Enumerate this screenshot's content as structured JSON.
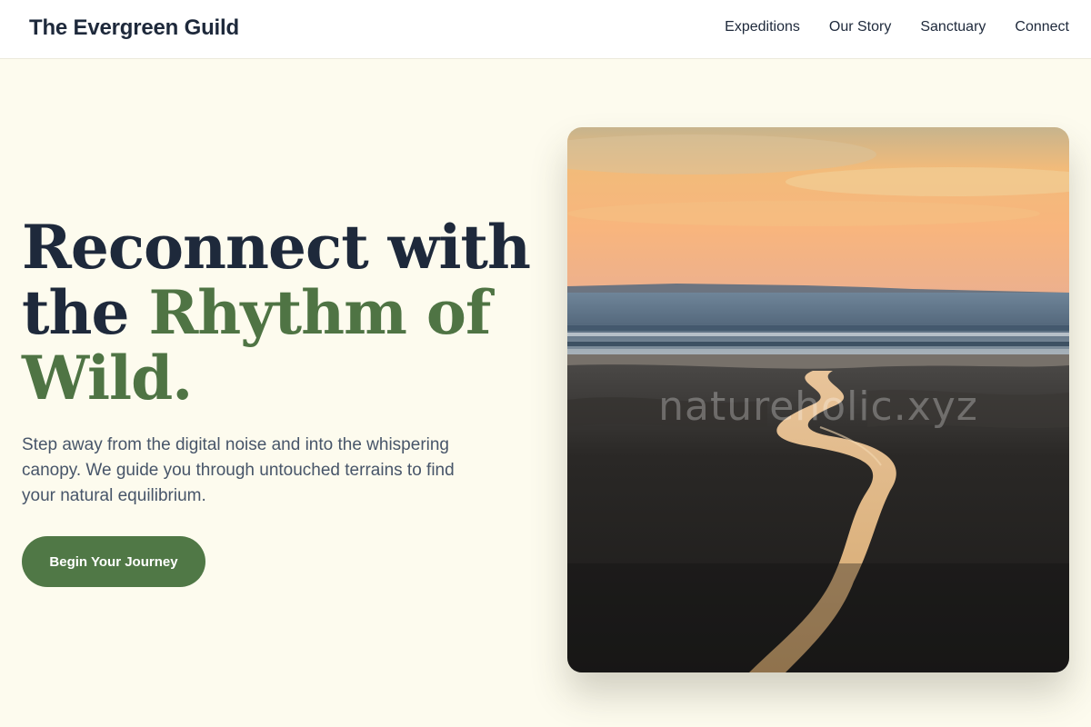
{
  "header": {
    "brand": "The Evergreen Guild",
    "nav": [
      {
        "label": "Expeditions"
      },
      {
        "label": "Our Story"
      },
      {
        "label": "Sanctuary"
      },
      {
        "label": "Connect"
      }
    ]
  },
  "hero": {
    "title_part1": "Reconnect with the ",
    "title_accent": "Rhythm of Wild.",
    "description": "Step away from the digital noise and into the whispering canopy. We guide you through untouched terrains to find your natural equilibrium.",
    "cta_label": "Begin Your Journey"
  },
  "image": {
    "watermark": "natureholic.xyz"
  },
  "colors": {
    "background": "#fdfbee",
    "text": "#1e293b",
    "accent": "#4f7444",
    "button": "#507846"
  }
}
